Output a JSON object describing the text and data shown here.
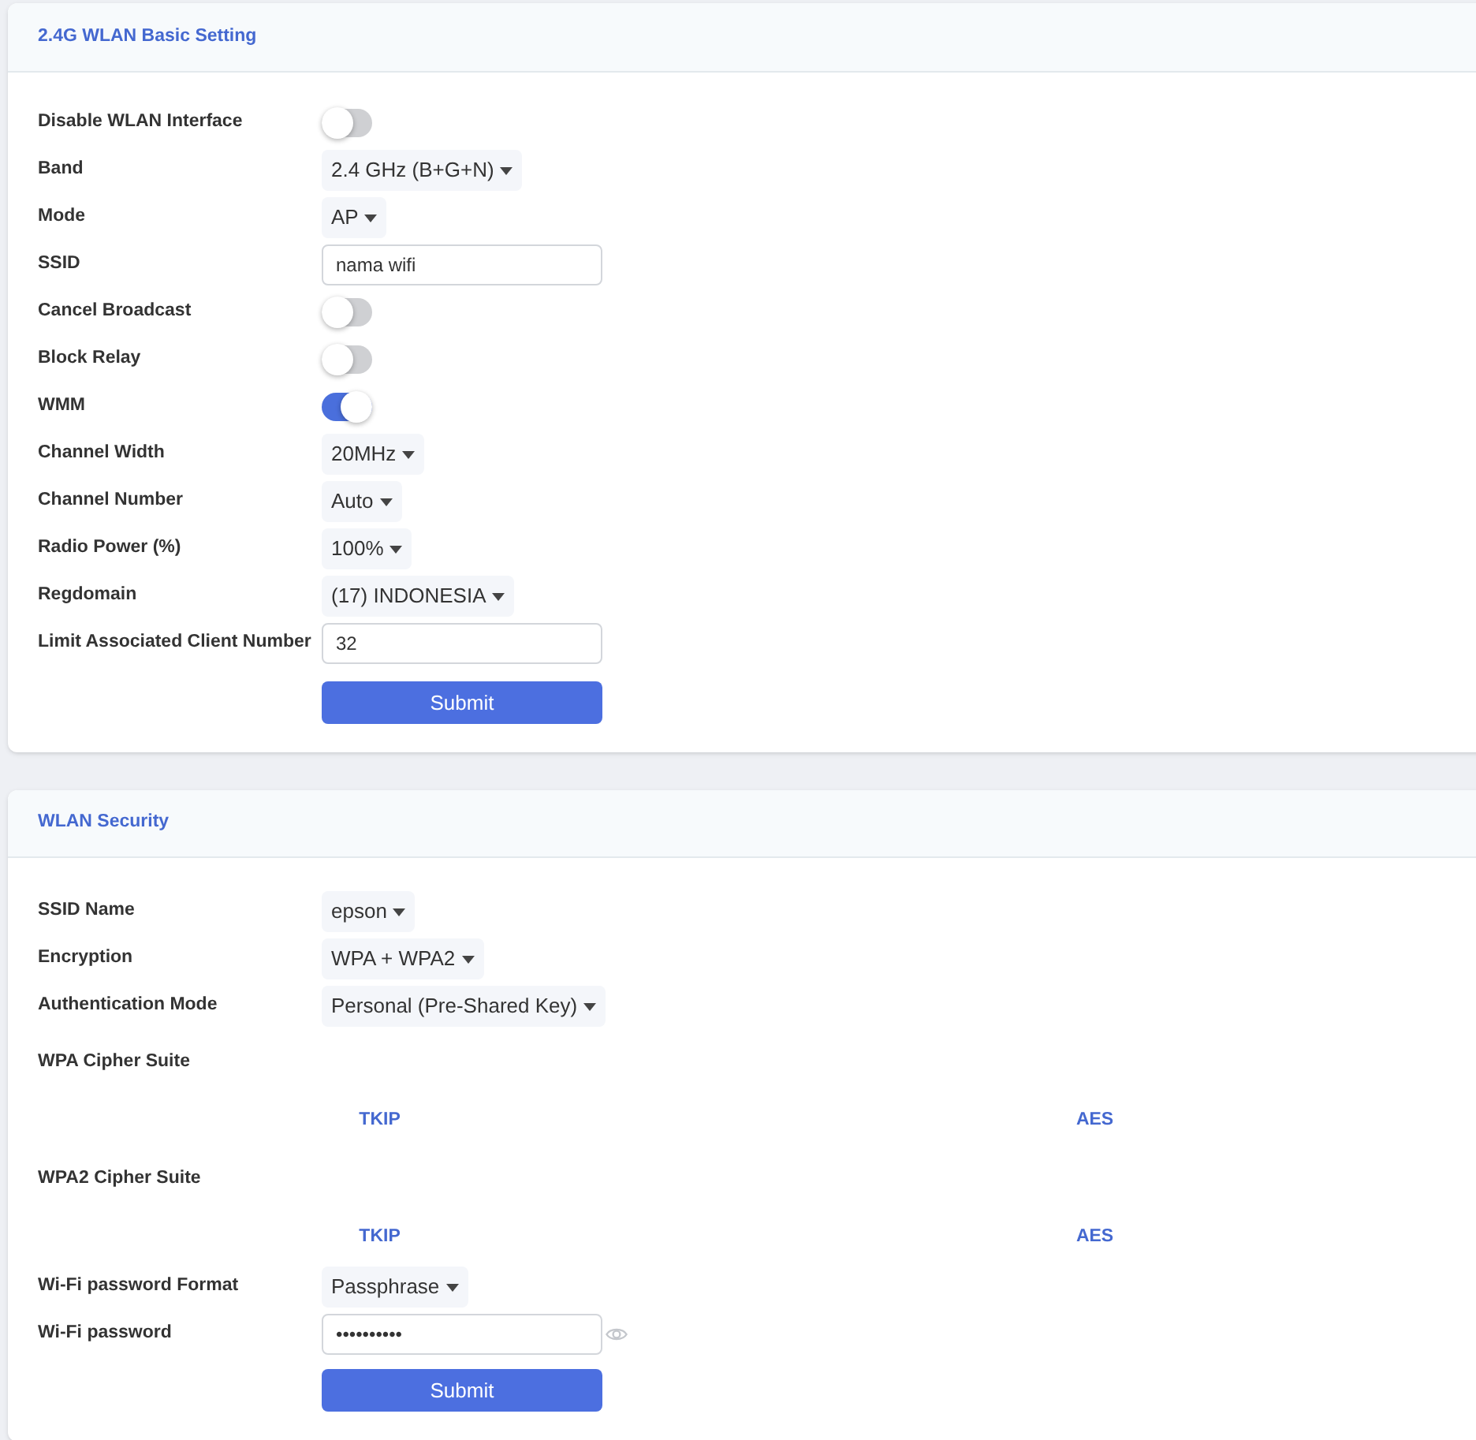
{
  "sections": [
    {
      "title": "2.4G WLAN Basic Setting",
      "fields": [
        {
          "kind": "toggle",
          "label": "Disable WLAN Interface",
          "on": false
        },
        {
          "kind": "select",
          "label": "Band",
          "value": "2.4 GHz (B+G+N)"
        },
        {
          "kind": "select",
          "label": "Mode",
          "value": "AP"
        },
        {
          "kind": "text",
          "label": "SSID",
          "value": "nama wifi"
        },
        {
          "kind": "toggle",
          "label": "Cancel Broadcast",
          "on": false
        },
        {
          "kind": "toggle",
          "label": "Block Relay",
          "on": false
        },
        {
          "kind": "toggle",
          "label": "WMM",
          "on": true
        },
        {
          "kind": "select",
          "label": "Channel Width",
          "value": "20MHz"
        },
        {
          "kind": "select",
          "label": "Channel Number",
          "value": "Auto"
        },
        {
          "kind": "select",
          "label": "Radio Power (%)",
          "value": "100%"
        },
        {
          "kind": "select",
          "label": "Regdomain",
          "value": "(17) INDONESIA"
        },
        {
          "kind": "text",
          "label": "Limit Associated Client Number",
          "value": "32"
        }
      ],
      "submit": "Submit"
    },
    {
      "title": "WLAN Security",
      "fields": [
        {
          "kind": "select",
          "label": "SSID Name",
          "value": "epson"
        },
        {
          "kind": "select",
          "label": "Encryption",
          "value": "WPA + WPA2"
        },
        {
          "kind": "select",
          "label": "Authentication Mode",
          "value": "Personal (Pre-Shared Key)"
        },
        {
          "kind": "heading",
          "label": "WPA Cipher Suite"
        },
        {
          "kind": "options",
          "options": [
            "TKIP",
            "AES"
          ]
        },
        {
          "kind": "heading",
          "label": "WPA2 Cipher Suite"
        },
        {
          "kind": "options",
          "options": [
            "TKIP",
            "AES"
          ]
        },
        {
          "kind": "select",
          "label": "Wi-Fi password Format",
          "value": "Passphrase"
        },
        {
          "kind": "password",
          "label": "Wi-Fi password",
          "value": "••••••••••"
        }
      ],
      "submit": "Submit"
    }
  ]
}
